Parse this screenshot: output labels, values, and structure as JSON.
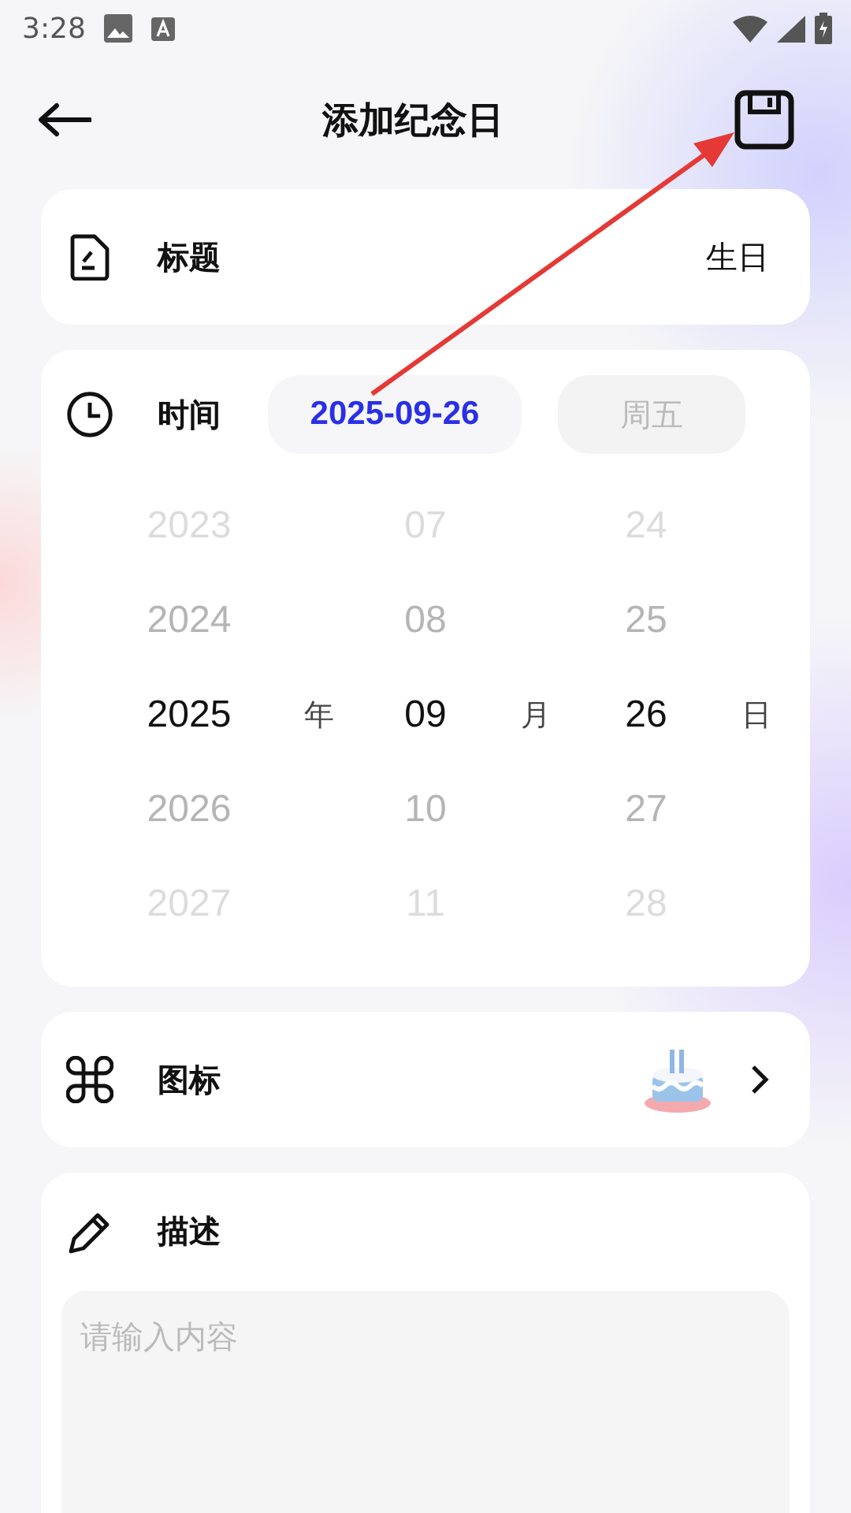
{
  "status_bar": {
    "time": "3:28"
  },
  "header": {
    "title": "添加纪念日"
  },
  "title_row": {
    "label": "标题",
    "value": "生日"
  },
  "time_row": {
    "label": "时间",
    "date": "2025-09-26",
    "weekday": "周五"
  },
  "picker": {
    "columns": [
      {
        "unit": "年",
        "items": [
          {
            "text": "2023",
            "selected": false
          },
          {
            "text": "2024",
            "selected": false
          },
          {
            "text": "2025",
            "selected": true
          },
          {
            "text": "2026",
            "selected": false
          },
          {
            "text": "2027",
            "selected": false
          }
        ]
      },
      {
        "unit": "月",
        "items": [
          {
            "text": "07",
            "selected": false
          },
          {
            "text": "08",
            "selected": false
          },
          {
            "text": "09",
            "selected": true
          },
          {
            "text": "10",
            "selected": false
          },
          {
            "text": "11",
            "selected": false
          }
        ]
      },
      {
        "unit": "日",
        "items": [
          {
            "text": "24",
            "selected": false
          },
          {
            "text": "25",
            "selected": false
          },
          {
            "text": "26",
            "selected": true
          },
          {
            "text": "27",
            "selected": false
          },
          {
            "text": "28",
            "selected": false
          }
        ]
      }
    ]
  },
  "icon_row": {
    "label": "图标"
  },
  "description": {
    "label": "描述",
    "placeholder": "请输入内容"
  }
}
